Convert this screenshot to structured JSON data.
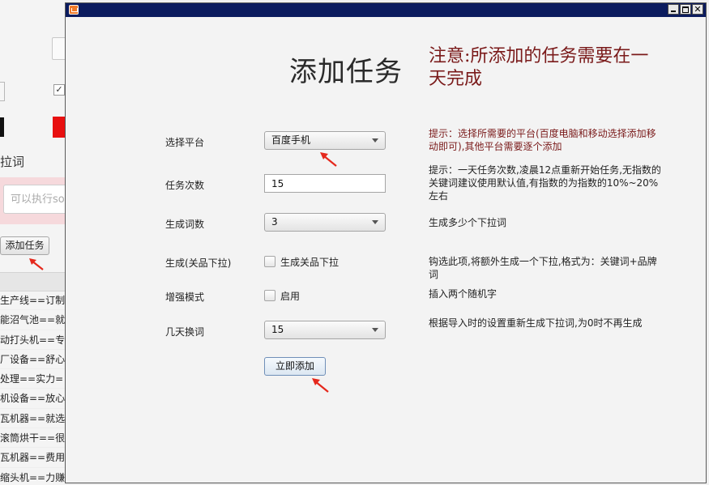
{
  "background_window": {
    "partial_word": "拉词",
    "input_placeholder": "可以执行so",
    "add_task_button": "添加任务",
    "rows": [
      "生产线==订制",
      "能沼气池==就",
      "动打头机==专",
      "厂设备==舒心",
      "处理==实力=",
      "机设备==放心",
      "瓦机器==就选",
      "滚筒烘干==很",
      "瓦机器==费用",
      "缩头机==力赚"
    ]
  },
  "dialog": {
    "title": "添加任务",
    "notice": "注意:所添加的任务需要在一天完成",
    "fields": {
      "platform": {
        "label": "选择平台",
        "value": "百度手机",
        "hint": "提示：选择所需要的平台(百度电脑和移动选择添加移动即可),其他平台需要逐个添加"
      },
      "task_count": {
        "label": "任务次数",
        "value": "15",
        "hint": "提示：一天任务次数,凌晨12点重新开始任务,无指数的关键词建议使用默认值,有指数的为指数的10%~20%左右"
      },
      "word_count": {
        "label": "生成词数",
        "value": "3",
        "hint": "生成多少个下拉词"
      },
      "related": {
        "label": "生成(关品下拉)",
        "checkbox_label": "生成关品下拉",
        "checked": false,
        "hint": "钩选此项,将额外生成一个下拉,格式为：关键词+品牌词"
      },
      "enhanced": {
        "label": "增强模式",
        "checkbox_label": "启用",
        "checked": false,
        "hint": "插入两个随机字"
      },
      "change_days": {
        "label": "几天换词",
        "value": "15",
        "hint": "根据导入时的设置重新生成下拉词,为0时不再生成"
      }
    },
    "submit_label": "立即添加"
  },
  "colors": {
    "titlebar": "#0b1b5e",
    "notice": "#7a1a1a",
    "annotation_arrow": "#e5281c"
  }
}
